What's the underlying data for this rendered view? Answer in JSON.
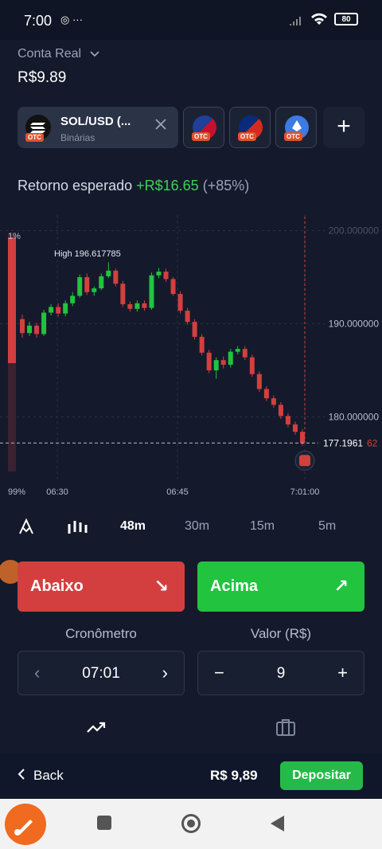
{
  "status": {
    "time": "7:00",
    "left_icons": "◎ ···",
    "battery": "80"
  },
  "account": {
    "type": "Conta Real",
    "balance": "R$9.89"
  },
  "asset": {
    "name": "SOL/USD (...",
    "subtitle": "Binárias",
    "tag": "OTC"
  },
  "other_assets": [
    {
      "name": "eur-gbp-otc",
      "colors": [
        "#1f3f99",
        "#c8102e"
      ]
    },
    {
      "name": "aud-chf-otc",
      "colors": [
        "#0a2a7a",
        "#d52b1e"
      ]
    },
    {
      "name": "crypto-otc",
      "colors": [
        "#3d7be3",
        "#ffffff"
      ]
    }
  ],
  "payout": {
    "label": "Retorno esperado",
    "amount": "+R$16.65",
    "percent": "(+85%)"
  },
  "chart_data": {
    "type": "candlestick",
    "annotations": {
      "high_label": "High 196.617785",
      "percent_top": "1%",
      "percent_bottom": "99%"
    },
    "y_ticks": [
      "200.000000",
      "190.000000",
      "180.000000"
    ],
    "ylim": [
      175,
      201.5
    ],
    "x_ticks": [
      "06:30",
      "06:45",
      "7:01:00"
    ],
    "current_price": "177.1961",
    "current_price_tail": "62",
    "candles": [
      {
        "o": 190.5,
        "c": 189.0,
        "h": 191.0,
        "l": 188.5
      },
      {
        "o": 189.0,
        "c": 189.8,
        "h": 190.2,
        "l": 188.7
      },
      {
        "o": 189.8,
        "c": 188.9,
        "h": 190.1,
        "l": 188.5
      },
      {
        "o": 188.9,
        "c": 191.2,
        "h": 191.5,
        "l": 188.7
      },
      {
        "o": 191.2,
        "c": 191.8,
        "h": 192.1,
        "l": 190.9
      },
      {
        "o": 191.8,
        "c": 191.1,
        "h": 192.2,
        "l": 190.8
      },
      {
        "o": 191.1,
        "c": 192.2,
        "h": 192.5,
        "l": 190.8
      },
      {
        "o": 192.2,
        "c": 193.0,
        "h": 193.4,
        "l": 191.9
      },
      {
        "o": 193.0,
        "c": 195.0,
        "h": 195.3,
        "l": 192.8
      },
      {
        "o": 195.0,
        "c": 193.4,
        "h": 195.4,
        "l": 193.1
      },
      {
        "o": 193.4,
        "c": 193.8,
        "h": 194.0,
        "l": 193.0
      },
      {
        "o": 193.8,
        "c": 195.1,
        "h": 195.4,
        "l": 193.6
      },
      {
        "o": 195.1,
        "c": 195.7,
        "h": 196.6,
        "l": 194.9
      },
      {
        "o": 195.7,
        "c": 194.3,
        "h": 195.9,
        "l": 194.0
      },
      {
        "o": 194.3,
        "c": 192.1,
        "h": 194.6,
        "l": 191.8
      },
      {
        "o": 192.1,
        "c": 191.6,
        "h": 192.4,
        "l": 191.3
      },
      {
        "o": 191.6,
        "c": 192.2,
        "h": 192.5,
        "l": 191.3
      },
      {
        "o": 192.2,
        "c": 191.7,
        "h": 192.5,
        "l": 191.4
      },
      {
        "o": 191.7,
        "c": 195.2,
        "h": 195.5,
        "l": 191.5
      },
      {
        "o": 195.2,
        "c": 195.6,
        "h": 196.0,
        "l": 194.9
      },
      {
        "o": 195.6,
        "c": 194.8,
        "h": 195.9,
        "l": 194.5
      },
      {
        "o": 194.8,
        "c": 193.2,
        "h": 195.0,
        "l": 193.0
      },
      {
        "o": 193.2,
        "c": 191.4,
        "h": 193.5,
        "l": 191.1
      },
      {
        "o": 191.4,
        "c": 190.2,
        "h": 191.7,
        "l": 189.9
      },
      {
        "o": 190.2,
        "c": 188.6,
        "h": 190.5,
        "l": 188.3
      },
      {
        "o": 188.6,
        "c": 186.9,
        "h": 188.9,
        "l": 186.6
      },
      {
        "o": 186.9,
        "c": 185.0,
        "h": 187.2,
        "l": 184.7
      },
      {
        "o": 185.0,
        "c": 186.1,
        "h": 186.4,
        "l": 184.1
      },
      {
        "o": 186.1,
        "c": 185.6,
        "h": 186.5,
        "l": 185.2
      },
      {
        "o": 185.6,
        "c": 187.0,
        "h": 187.3,
        "l": 185.3
      },
      {
        "o": 187.0,
        "c": 187.3,
        "h": 187.6,
        "l": 186.7
      },
      {
        "o": 187.3,
        "c": 186.4,
        "h": 187.6,
        "l": 186.1
      },
      {
        "o": 186.4,
        "c": 184.6,
        "h": 186.7,
        "l": 184.3
      },
      {
        "o": 184.6,
        "c": 183.0,
        "h": 184.9,
        "l": 182.7
      },
      {
        "o": 183.0,
        "c": 182.0,
        "h": 183.3,
        "l": 181.7
      },
      {
        "o": 182.0,
        "c": 181.3,
        "h": 182.3,
        "l": 181.0
      },
      {
        "o": 181.3,
        "c": 180.1,
        "h": 181.6,
        "l": 179.8
      },
      {
        "o": 180.1,
        "c": 179.2,
        "h": 180.4,
        "l": 178.9
      },
      {
        "o": 179.2,
        "c": 178.4,
        "h": 179.5,
        "l": 178.1
      },
      {
        "o": 178.4,
        "c": 177.2,
        "h": 178.7,
        "l": 176.9
      }
    ]
  },
  "timeframes": [
    "48m",
    "30m",
    "15m",
    "5m"
  ],
  "actions": {
    "down": "Abaixo",
    "up": "Acima",
    "down_arrow": "↘",
    "up_arrow": "↗"
  },
  "timer": {
    "label": "Cronômetro",
    "value": "07:01",
    "prev": "‹",
    "next": "›"
  },
  "amount": {
    "label": "Valor (R$)",
    "value": "9",
    "minus": "−",
    "plus": "+"
  },
  "footer": {
    "back": "Back",
    "balance": "R$ 9,89",
    "deposit": "Depositar"
  },
  "colors": {
    "up": "#21c33f",
    "down": "#d33f3f",
    "bg": "#141a2b"
  }
}
